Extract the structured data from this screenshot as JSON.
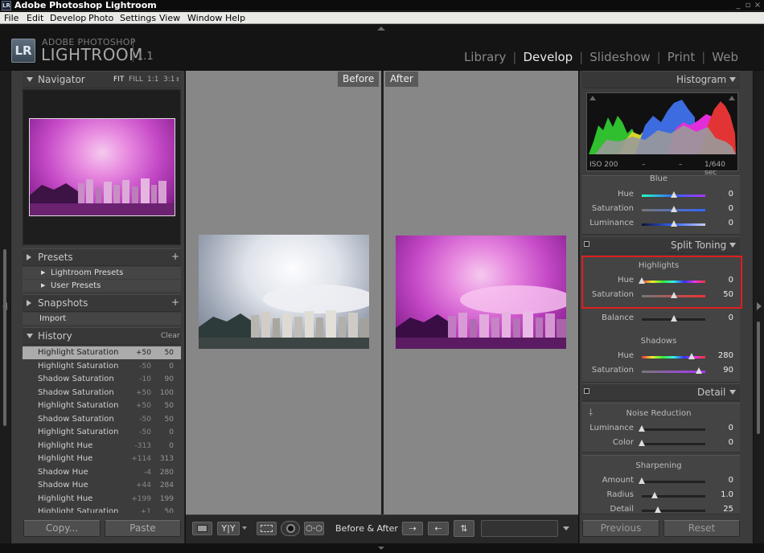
{
  "window": {
    "title": "Adobe Photoshop Lightroom",
    "icon": "LR",
    "controls": [
      "_",
      "▫",
      "×"
    ]
  },
  "menu": [
    "File",
    "Edit",
    "Develop",
    "Photo",
    "Settings",
    "View",
    "Window",
    "Help"
  ],
  "brand": {
    "logo": "LR",
    "line1": "ADOBE PHOTOSHOP",
    "line2": "LIGHTROOM",
    "version": "1.1"
  },
  "modules": [
    {
      "label": "Library"
    },
    {
      "label": "Develop",
      "active": true
    },
    {
      "label": "Slideshow"
    },
    {
      "label": "Print"
    },
    {
      "label": "Web"
    }
  ],
  "navigator": {
    "title": "Navigator",
    "zoom": [
      "FIT",
      "FILL",
      "1:1",
      "3:1"
    ]
  },
  "presets": {
    "title": "Presets",
    "add": "+",
    "items": [
      "Lightroom Presets",
      "User Presets"
    ]
  },
  "snapshots": {
    "title": "Snapshots",
    "add": "+",
    "items": [
      "Import"
    ]
  },
  "history": {
    "title": "History",
    "clear": "Clear",
    "rows": [
      {
        "name": "Highlight Saturation",
        "before": "+50",
        "after": "50",
        "selected": true
      },
      {
        "name": "Highlight Saturation",
        "before": "-50",
        "after": "0"
      },
      {
        "name": "Shadow Saturation",
        "before": "-10",
        "after": "90"
      },
      {
        "name": "Shadow Saturation",
        "before": "+50",
        "after": "100"
      },
      {
        "name": "Highlight Saturation",
        "before": "+50",
        "after": "50"
      },
      {
        "name": "Shadow Saturation",
        "before": "-50",
        "after": "50"
      },
      {
        "name": "Highlight Saturation",
        "before": "-50",
        "after": "0"
      },
      {
        "name": "Highlight Hue",
        "before": "-313",
        "after": "0"
      },
      {
        "name": "Highlight Hue",
        "before": "+114",
        "after": "313"
      },
      {
        "name": "Shadow Hue",
        "before": "-4",
        "after": "280"
      },
      {
        "name": "Shadow Hue",
        "before": "+44",
        "after": "284"
      },
      {
        "name": "Highlight Hue",
        "before": "+199",
        "after": "199"
      },
      {
        "name": "Highlight Saturation",
        "before": "+1",
        "after": "50"
      }
    ]
  },
  "left_buttons": {
    "copy": "Copy...",
    "paste": "Paste"
  },
  "compare": {
    "before": "Before",
    "after": "After"
  },
  "toolbar": {
    "label": "Before & After :"
  },
  "histogram": {
    "title": "Histogram",
    "iso": "ISO 200",
    "dash1": "–",
    "dash2": "–",
    "shutter": "1/640 sec"
  },
  "hsl": {
    "group_title": "Blue",
    "sliders": [
      {
        "label": "Hue",
        "value": "0"
      },
      {
        "label": "Saturation",
        "value": "0"
      },
      {
        "label": "Luminance",
        "value": "0"
      }
    ]
  },
  "split_toning": {
    "title": "Split Toning",
    "highlights": {
      "title": "Highlights",
      "hue": {
        "label": "Hue",
        "value": "0"
      },
      "saturation": {
        "label": "Saturation",
        "value": "50"
      }
    },
    "balance": {
      "label": "Balance",
      "value": "0"
    },
    "shadows": {
      "title": "Shadows",
      "hue": {
        "label": "Hue",
        "value": "280"
      },
      "saturation": {
        "label": "Saturation",
        "value": "90"
      }
    }
  },
  "detail": {
    "title": "Detail",
    "noise": {
      "title": "Noise Reduction",
      "luminance": {
        "label": "Luminance",
        "value": "0"
      },
      "color": {
        "label": "Color",
        "value": "0"
      }
    },
    "sharpening": {
      "title": "Sharpening",
      "amount": {
        "label": "Amount",
        "value": "0"
      },
      "radius": {
        "label": "Radius",
        "value": "1.0"
      },
      "detail": {
        "label": "Detail",
        "value": "25"
      }
    }
  },
  "right_buttons": {
    "previous": "Previous",
    "reset": "Reset"
  },
  "slider_levels": {
    "blue_hue": 0.5,
    "blue_sat": 0.5,
    "blue_lum": 0.5,
    "hl_hue": 0.0,
    "hl_sat": 0.5,
    "balance": 0.5,
    "sh_hue": 0.78,
    "sh_sat": 0.9,
    "nr_lum": 0.0,
    "nr_col": 0.0,
    "sh_amount": 0.0,
    "sh_radius": 0.2,
    "sh_detail": 0.25
  }
}
